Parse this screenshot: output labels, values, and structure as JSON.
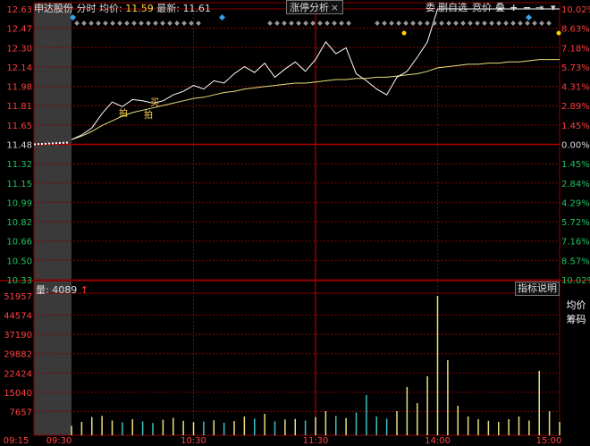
{
  "header": {
    "stock_name": "申达股份",
    "mode": "分时",
    "avg_label": "均价:",
    "avg_value": "11.59",
    "last_label": "最新:",
    "last_value": "11.61",
    "tab_label": "涨停分析",
    "tab_close": "×"
  },
  "toolbar": {
    "btn1": "委",
    "btn2": "删自选",
    "btn3": "竞价",
    "btn4": "叠",
    "btn5": "+",
    "btn6": "−",
    "btn7": "⇥",
    "btn8": "▾"
  },
  "side": {
    "avg_price": "均价",
    "chips": "筹码"
  },
  "volume": {
    "label": "量:",
    "value": "4089",
    "arrow": "↑",
    "index_btn": "指标说明"
  },
  "colors": {
    "price_line": "#ffffff",
    "avg_line": "#e8e07a",
    "up": "#ff3c3c",
    "down": "#20c060",
    "grid": "#8b0000"
  },
  "chart_data": {
    "type": "line",
    "price_axis": {
      "left_labels": [
        "12.63",
        "12.47",
        "12.30",
        "12.14",
        "11.98",
        "11.81",
        "11.65",
        "11.48",
        "11.32",
        "11.15",
        "10.99",
        "10.82",
        "10.66",
        "10.50",
        "10.33"
      ],
      "right_labels": [
        "10.02%",
        "8.63%",
        "7.18%",
        "5.73%",
        "4.31%",
        "2.89%",
        "1.45%",
        "0.00%",
        "1.45%",
        "2.84%",
        "4.29%",
        "5.72%",
        "7.16%",
        "8.57%",
        "10.02%"
      ],
      "ylim": [
        10.33,
        12.63
      ],
      "prev_close": 11.48
    },
    "volume_axis": {
      "labels": [
        "51957",
        "44574",
        "37190",
        "29882",
        "22424",
        "15040",
        "7657"
      ],
      "ylim": [
        0,
        51957
      ]
    },
    "time_labels": [
      "09:15",
      "09:30",
      "10:30",
      "11:30",
      "14:00",
      "15:00"
    ],
    "annotations": [
      "拍",
      "买",
      "拍"
    ],
    "x_minutes": [
      0,
      5,
      10,
      15,
      20,
      25,
      30,
      35,
      40,
      45,
      50,
      55,
      60,
      65,
      70,
      75,
      80,
      85,
      90,
      95,
      100,
      105,
      110,
      115,
      120,
      125,
      130,
      135,
      140,
      145,
      150,
      155,
      160,
      165,
      170,
      175,
      180,
      185,
      190,
      195,
      200,
      205,
      210,
      215,
      220,
      225,
      230,
      235,
      240
    ],
    "price": [
      11.52,
      11.56,
      11.62,
      11.74,
      11.84,
      11.8,
      11.86,
      11.85,
      11.83,
      11.85,
      11.9,
      11.93,
      11.98,
      11.95,
      12.02,
      12.0,
      12.08,
      12.14,
      12.09,
      12.17,
      12.05,
      12.12,
      12.18,
      12.1,
      12.2,
      12.35,
      12.25,
      12.3,
      12.08,
      12.02,
      11.95,
      11.9,
      12.05,
      12.1,
      12.22,
      12.35,
      12.63,
      12.63,
      12.63,
      12.63,
      12.63,
      12.63,
      12.63,
      12.63,
      12.63,
      12.63,
      12.63,
      12.63,
      12.63
    ],
    "avg_price": [
      11.52,
      11.55,
      11.59,
      11.64,
      11.68,
      11.72,
      11.75,
      11.77,
      11.79,
      11.81,
      11.83,
      11.85,
      11.87,
      11.88,
      11.9,
      11.92,
      11.93,
      11.95,
      11.96,
      11.97,
      11.98,
      11.99,
      12.0,
      12.0,
      12.01,
      12.02,
      12.03,
      12.03,
      12.04,
      12.04,
      12.05,
      12.05,
      12.06,
      12.07,
      12.08,
      12.1,
      12.13,
      12.14,
      12.15,
      12.16,
      12.16,
      12.17,
      12.17,
      12.18,
      12.18,
      12.19,
      12.2,
      12.2,
      12.2
    ],
    "volume": [
      3500,
      5000,
      6800,
      7200,
      5500,
      4800,
      6000,
      5200,
      4600,
      5800,
      6500,
      5400,
      4900,
      5100,
      5600,
      4700,
      5300,
      7000,
      6200,
      8000,
      5200,
      5900,
      6100,
      5500,
      6800,
      9000,
      7200,
      6400,
      8500,
      15000,
      7000,
      6200,
      9000,
      18000,
      12000,
      22000,
      51957,
      28000,
      11000,
      7000,
      6000,
      5400,
      5000,
      6000,
      7000,
      5500,
      24000,
      9000,
      5000
    ],
    "pre_auction_price": 11.48
  }
}
